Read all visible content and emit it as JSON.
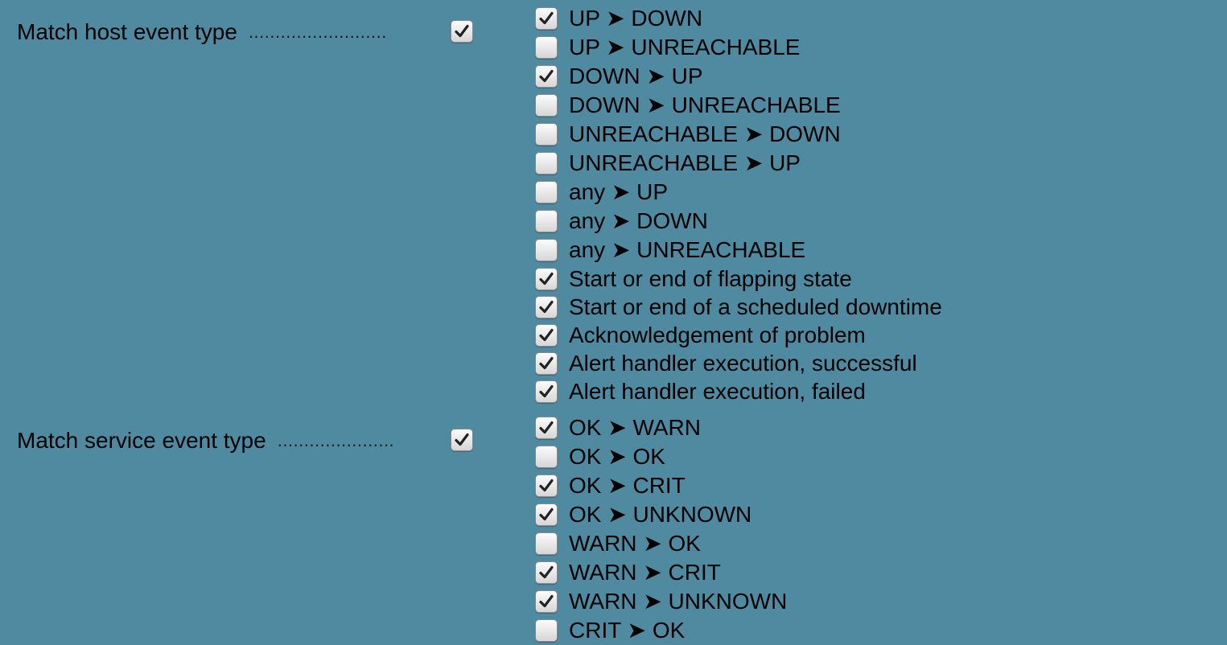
{
  "host_section": {
    "label": "Match host event type",
    "dots": "..........................",
    "enabled": true,
    "options": [
      {
        "label": "UP ➤ DOWN",
        "checked": true
      },
      {
        "label": "UP ➤ UNREACHABLE",
        "checked": false
      },
      {
        "label": "DOWN ➤ UP",
        "checked": true
      },
      {
        "label": "DOWN ➤ UNREACHABLE",
        "checked": false
      },
      {
        "label": "UNREACHABLE ➤ DOWN",
        "checked": false
      },
      {
        "label": "UNREACHABLE ➤ UP",
        "checked": false
      },
      {
        "label": "any ➤ UP",
        "checked": false
      },
      {
        "label": "any ➤ DOWN",
        "checked": false
      },
      {
        "label": "any ➤ UNREACHABLE",
        "checked": false
      },
      {
        "label": "Start or end of flapping state",
        "checked": true
      },
      {
        "label": "Start or end of a scheduled downtime",
        "checked": true
      },
      {
        "label": "Acknowledgement of problem",
        "checked": true
      },
      {
        "label": "Alert handler execution, successful",
        "checked": true
      },
      {
        "label": "Alert handler execution, failed",
        "checked": true
      }
    ]
  },
  "service_section": {
    "label": "Match service event type",
    "dots": "......................",
    "enabled": true,
    "options": [
      {
        "label": "OK ➤ WARN",
        "checked": true
      },
      {
        "label": "OK ➤ OK",
        "checked": false
      },
      {
        "label": "OK ➤ CRIT",
        "checked": true
      },
      {
        "label": "OK ➤ UNKNOWN",
        "checked": true
      },
      {
        "label": "WARN ➤ OK",
        "checked": false
      },
      {
        "label": "WARN ➤ CRIT",
        "checked": true
      },
      {
        "label": "WARN ➤ UNKNOWN",
        "checked": true
      },
      {
        "label": "CRIT ➤ OK",
        "checked": false
      }
    ]
  },
  "icons": {
    "check": "checkmark-icon"
  }
}
